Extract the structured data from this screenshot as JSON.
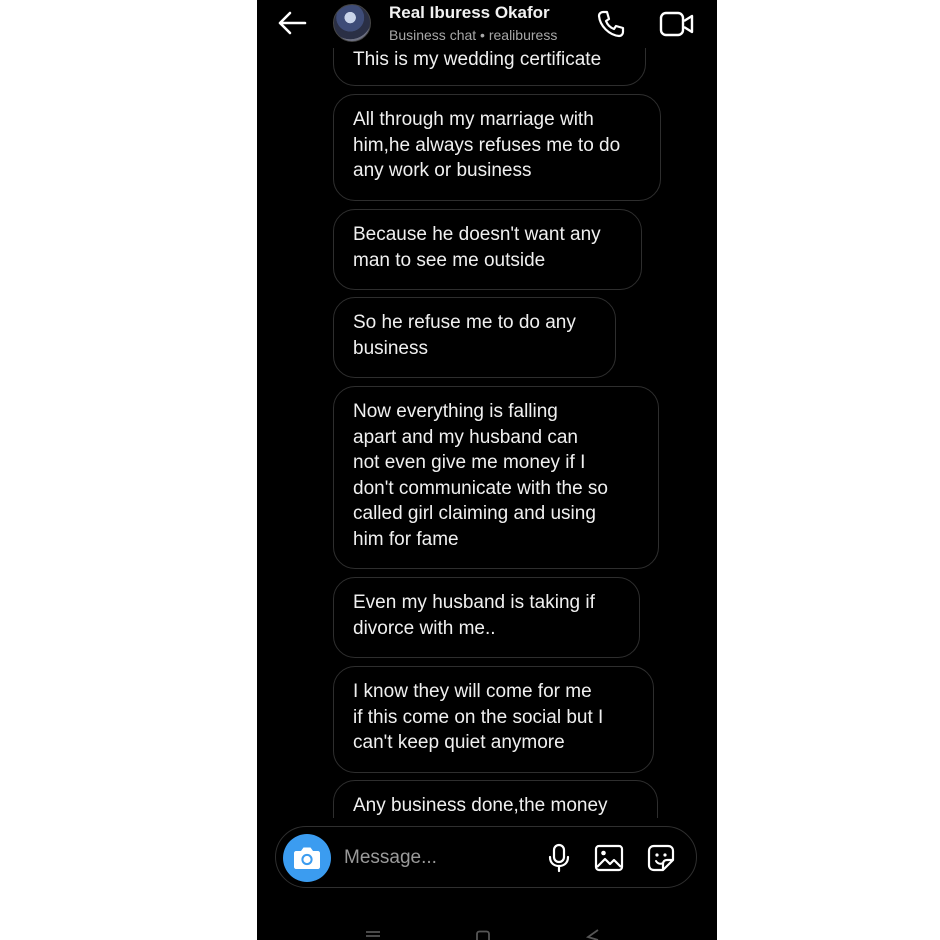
{
  "header": {
    "name": "Real Iburess Okafor",
    "subtitle": "Business chat • realiburess",
    "icons": [
      "back-arrow-icon",
      "avatar",
      "phone-icon",
      "video-camera-icon"
    ]
  },
  "messages": [
    {
      "lines": [
        "This is my wedding certificate"
      ]
    },
    {
      "lines": [
        "All through my marriage with",
        "him,he always refuses me to do",
        "any work or business"
      ]
    },
    {
      "lines": [
        "Because he doesn't want any",
        "man to see me outside"
      ]
    },
    {
      "lines": [
        "So he refuse me to do any",
        "business"
      ]
    },
    {
      "lines": [
        "Now everything is falling",
        "apart and my husband can",
        "not even give me money if I",
        "don't communicate with the so",
        "called girl claiming and using",
        "him for fame"
      ]
    },
    {
      "lines": [
        "Even my husband is taking if",
        "divorce with me.."
      ]
    },
    {
      "lines": [
        "I know they will come for me",
        "if this come on the social but I",
        "can't keep quiet anymore"
      ]
    },
    {
      "lines": [
        "Any business done,the money"
      ]
    }
  ],
  "composer": {
    "placeholder": "Message...",
    "icons": [
      "camera-icon",
      "microphone-icon",
      "gallery-icon",
      "sticker-icon"
    ],
    "camera_color": "#3b9cf0"
  },
  "colors": {
    "background": "#000000",
    "bubble_border": "#2e2e2e",
    "text": "#f0f0f0",
    "subtext": "#a8a8a8"
  }
}
